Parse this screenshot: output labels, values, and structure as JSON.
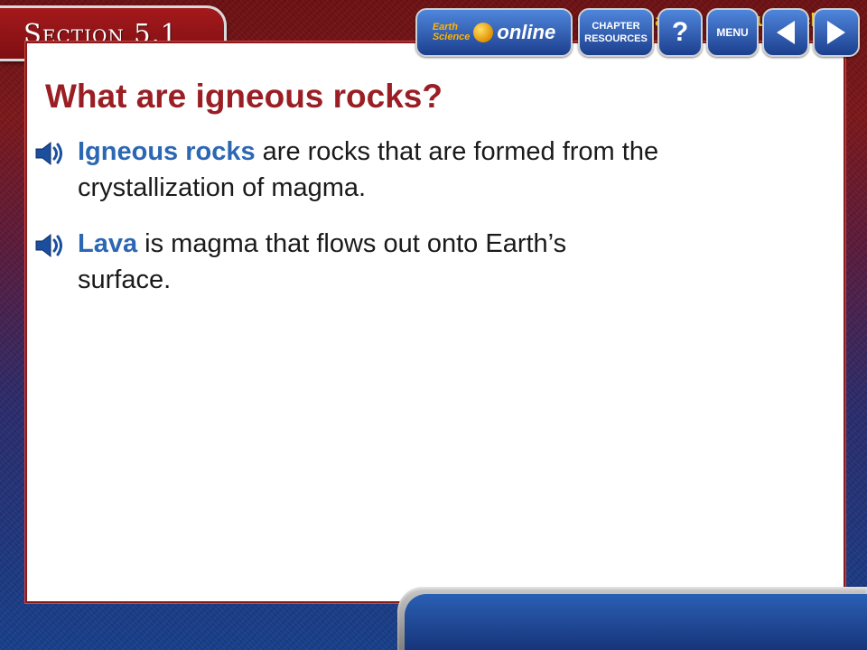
{
  "header": {
    "section_label": "Section 5.1",
    "topic_title": "What are igneous rocks?"
  },
  "slide": {
    "title": "What are igneous rocks?",
    "bullets": [
      {
        "term": "Igneous rocks",
        "text": " are rocks that are formed from the crystallization of magma."
      },
      {
        "term": "Lava",
        "text": " is magma that flows out onto Earth’s surface."
      }
    ]
  },
  "navbar": {
    "online_brand_top": "Earth",
    "online_brand_bottom": "Science",
    "online_word": "online",
    "chapter_resources_line1": "CHAPTER",
    "chapter_resources_line2": "RESOURCES",
    "help_label": "?",
    "menu_label": "MENU"
  },
  "icons": {
    "speaker": "speaker-icon",
    "prev": "arrow-left-icon",
    "next": "arrow-right-icon"
  },
  "colors": {
    "title": "#9a1f24",
    "term": "#2b67b3",
    "header_title": "#ffd21a",
    "section_tab": "#a4191c",
    "nav_blue": "#2a5fb4"
  }
}
